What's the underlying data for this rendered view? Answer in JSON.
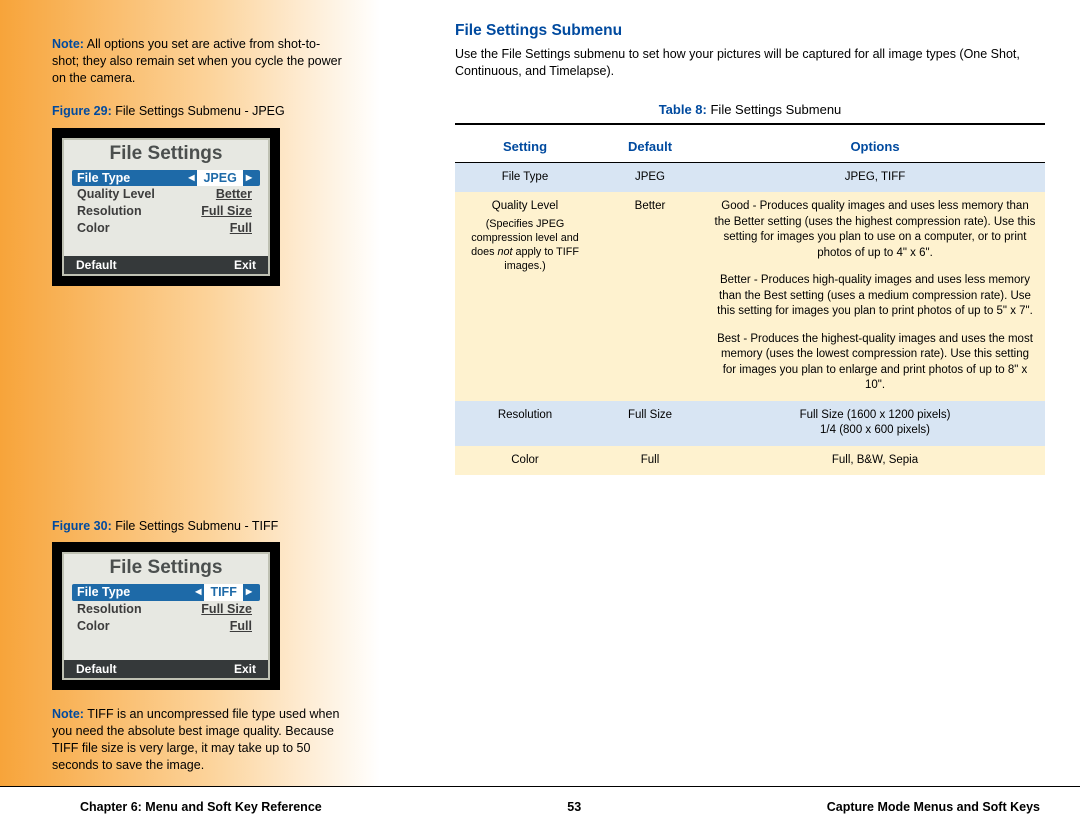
{
  "sidebar": {
    "noteLabel": "Note:",
    "noteText": " All options you set are active from shot-to-shot; they also remain set when you cycle the power on the camera.",
    "fig29Label": "Figure 29:",
    "fig29Text": " File Settings Submenu - JPEG",
    "lcd1": {
      "title": "File Settings",
      "rows": [
        {
          "label": "File Type",
          "value": "JPEG",
          "selected": true
        },
        {
          "label": "Quality Level",
          "value": "Better",
          "selected": false
        },
        {
          "label": "Resolution",
          "value": "Full Size",
          "selected": false
        },
        {
          "label": "Color",
          "value": "Full",
          "selected": false
        }
      ],
      "bottomLeft": "Default",
      "bottomRight": "Exit"
    },
    "fig30Label": "Figure 30:",
    "fig30Text": " File Settings Submenu - TIFF",
    "lcd2": {
      "title": "File Settings",
      "rows": [
        {
          "label": "File Type",
          "value": "TIFF",
          "selected": true
        },
        {
          "label": "Resolution",
          "value": "Full Size",
          "selected": false
        },
        {
          "label": "Color",
          "value": "Full",
          "selected": false
        }
      ],
      "bottomLeft": "Default",
      "bottomRight": "Exit"
    },
    "note2Label": "Note:",
    "note2Text": " TIFF is an uncompressed file type used when you need the absolute best image quality. Because TIFF file size is very large, it may take up to 50 seconds to save the image."
  },
  "main": {
    "heading": "File Settings Submenu",
    "intro": "Use the File Settings submenu to set how your pictures will be captured for all image types (One Shot, Continuous, and Timelapse).",
    "tableLabel": "Table 8:",
    "tableTitle": " File Settings Submenu",
    "headers": {
      "c1": "Setting",
      "c2": "Default",
      "c3": "Options"
    },
    "rows": [
      {
        "setting": "File Type",
        "sub": "",
        "default": "JPEG",
        "options": [
          "JPEG, TIFF"
        ]
      },
      {
        "setting": "Quality Level",
        "sub": "(Specifies JPEG compression level and does <em>not</em> apply to TIFF images.)",
        "default": "Better",
        "options": [
          "Good - Produces quality images and uses less memory than the Better setting (uses the highest compression rate). Use this setting for images you plan to use on a computer, or to print photos of up to 4\" x 6\".",
          "Better - Produces high-quality images and uses less memory than the Best setting (uses a medium compression rate). Use this setting for images you plan to print photos of up to 5\" x 7\".",
          "Best - Produces the highest-quality images and uses the most memory (uses the lowest compression rate). Use this setting for images you plan to enlarge and print photos of up to 8\" x 10\"."
        ]
      },
      {
        "setting": "Resolution",
        "sub": "",
        "default": "Full Size",
        "options": [
          "Full Size (1600 x 1200 pixels)<br>1/4 (800 x 600 pixels)"
        ]
      },
      {
        "setting": "Color",
        "sub": "",
        "default": "Full",
        "options": [
          "Full, B&W, Sepia"
        ]
      }
    ]
  },
  "footer": {
    "left": "Chapter 6: Menu and Soft Key Reference",
    "center": "53",
    "right": "Capture Mode Menus and Soft Keys"
  }
}
